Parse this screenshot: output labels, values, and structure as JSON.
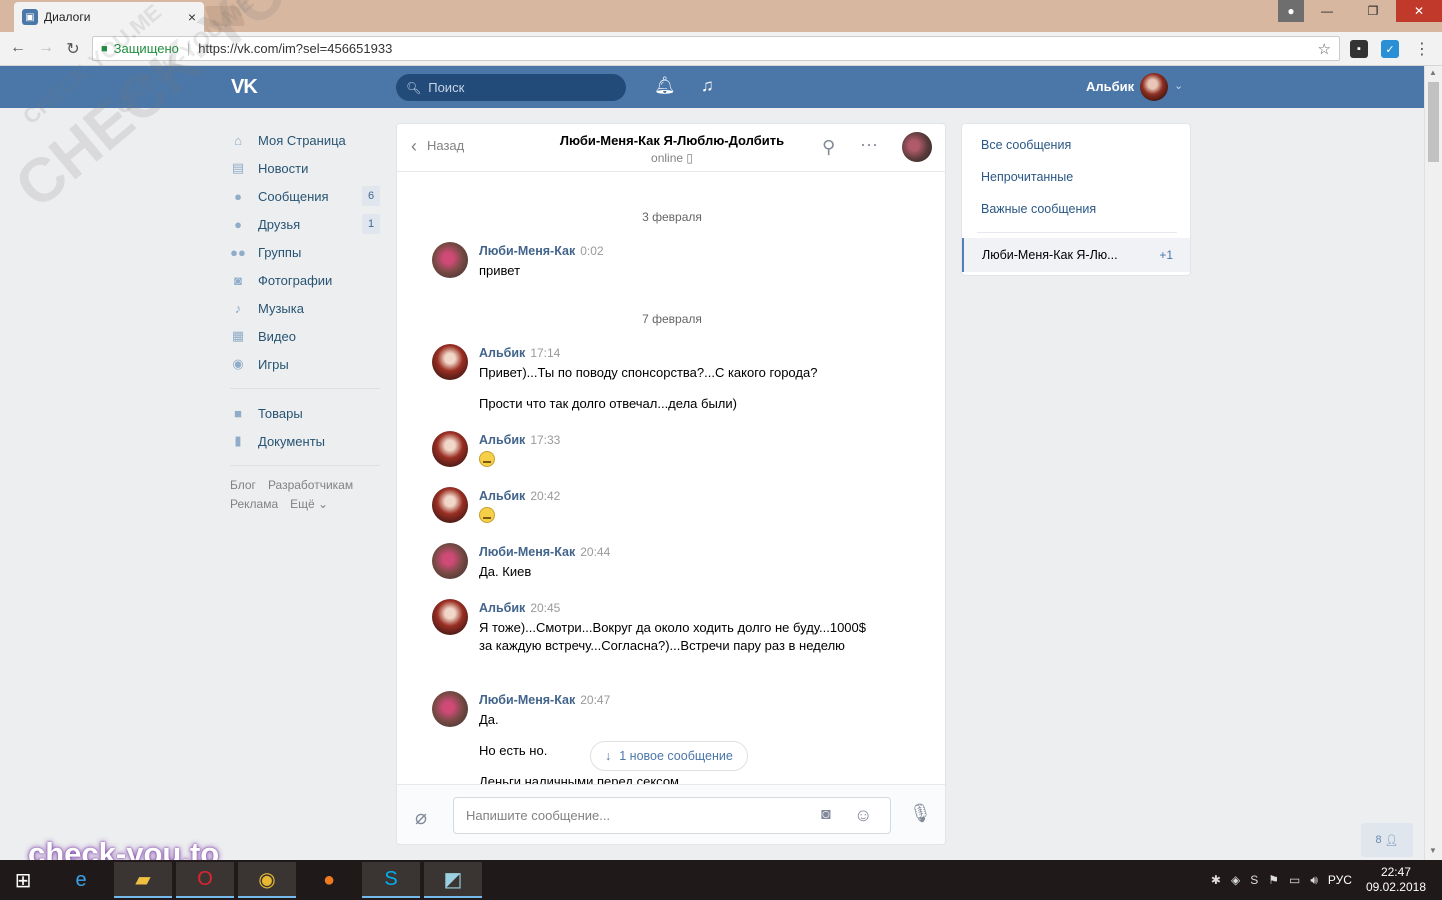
{
  "browser": {
    "tab_title": "Диалоги",
    "tab_close": "×",
    "secure_label": "Защищено",
    "url": "https://vk.com/im?sel=456651933",
    "window": {
      "minimize": "—",
      "restore": "❐",
      "close": "✕"
    }
  },
  "header": {
    "logo": "VK",
    "search_placeholder": "Поиск",
    "user_name": "Альбик"
  },
  "left_menu": {
    "items": [
      {
        "label": "Моя Страница",
        "icon": "home-icon"
      },
      {
        "label": "Новости",
        "icon": "news-icon"
      },
      {
        "label": "Сообщения",
        "icon": "messages-icon",
        "count": "6"
      },
      {
        "label": "Друзья",
        "icon": "friends-icon",
        "count": "1"
      },
      {
        "label": "Группы",
        "icon": "groups-icon"
      },
      {
        "label": "Фотографии",
        "icon": "camera-icon"
      },
      {
        "label": "Музыка",
        "icon": "music-icon"
      },
      {
        "label": "Видео",
        "icon": "video-icon"
      },
      {
        "label": "Игры",
        "icon": "games-icon"
      }
    ],
    "items2": [
      {
        "label": "Товары",
        "icon": "bag-icon"
      },
      {
        "label": "Документы",
        "icon": "document-icon"
      }
    ],
    "footer": {
      "blog": "Блог",
      "developers": "Разработчикам",
      "ads": "Реклама",
      "more": "Ещё ⌄"
    }
  },
  "chat": {
    "back_label": "Назад",
    "title": "Люби-Меня-Как Я-Люблю-Долбить",
    "status": "online ▯",
    "dates": [
      "3 февраля",
      "7 февраля"
    ],
    "messages": [
      {
        "author": "Люби-Меня-Как",
        "time": "0:02",
        "text": "привет"
      },
      {
        "author": "Альбик",
        "time": "17:14",
        "text": "Привет)...Ты по поводу спонсорства?...С какого города?"
      },
      {
        "text2": "Прости что так долго отвечал...дела были)"
      },
      {
        "author": "Альбик",
        "time": "17:33",
        "emoji": "smile-emoji"
      },
      {
        "author": "Альбик",
        "time": "20:42",
        "emoji": "smile-emoji"
      },
      {
        "author": "Люби-Меня-Как",
        "time": "20:44",
        "text": "Да. Киев"
      },
      {
        "author": "Альбик",
        "time": "20:45",
        "text": "Я тоже)...Смотри...Вокруг да около ходить долго не буду...1000$ за каждую встречу...Согласна?)...Встречи пару раз в неделю"
      },
      {
        "author": "Люби-Меня-Как",
        "time": "20:47",
        "text": "Да.",
        "text2": "Но есть но.",
        "text3": "Деньги наличными перед сексом"
      }
    ],
    "new_message_label": "1 новое сообщение",
    "composer_placeholder": "Напишите сообщение..."
  },
  "right_panel": {
    "all": "Все сообщения",
    "unread": "Непрочитанные",
    "important": "Важные сообщения",
    "active_dialog": "Люби-Меня-Как Я-Лю...",
    "active_badge": "+1"
  },
  "friends_online": "8",
  "watermark": {
    "big": "CHECK-YOU.ME",
    "small": "CHECK-YOU.ME",
    "small2": "CHECK-YOU.ME",
    "brand": "check-you.to"
  },
  "taskbar": {
    "lang": "РУС",
    "time": "22:47",
    "date": "09.02.2018"
  },
  "colors": {
    "vk_blue": "#4a76a8",
    "link": "#2a5885",
    "author": "#42648b"
  }
}
